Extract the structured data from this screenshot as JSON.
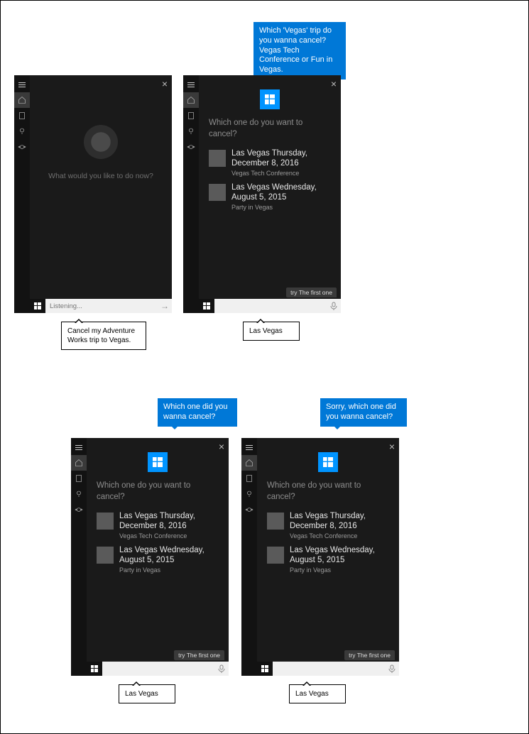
{
  "panel_idle": {
    "prompt": "What would you like to do now?",
    "search_placeholder": "Listening..."
  },
  "panel_list": {
    "prompt": "Which one do you want to cancel?",
    "hint": "try The first one",
    "items": [
      {
        "title": "Las Vegas Thursday, December 8, 2016",
        "subtitle": "Vegas Tech Conference"
      },
      {
        "title": "Las Vegas Wednesday, August 5, 2015",
        "subtitle": "Party in Vegas"
      }
    ]
  },
  "voice": {
    "v1": "Which 'Vegas' trip do you wanna cancel? Vegas Tech Conference or Fun in Vegas.",
    "v2": "Which one did you wanna cancel?",
    "v3": "Sorry, which one did you wanna cancel?"
  },
  "user": {
    "u1": "Cancel my Adventure Works trip to Vegas.",
    "u2": "Las Vegas",
    "u3": "Las Vegas",
    "u4": "Las Vegas"
  }
}
